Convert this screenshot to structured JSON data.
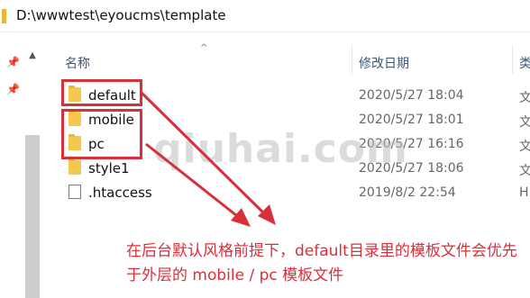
{
  "address_bar": {
    "path": "D:\\wwwtest\\eyoucms\\template"
  },
  "columns": {
    "name": "名称",
    "date": "修改日期",
    "type": "类"
  },
  "files": [
    {
      "name": "default",
      "date": "2020/5/27 18:04",
      "type": "文",
      "kind": "folder"
    },
    {
      "name": "mobile",
      "date": "2020/5/27 18:01",
      "type": "文",
      "kind": "folder"
    },
    {
      "name": "pc",
      "date": "2020/5/27 16:16",
      "type": "文",
      "kind": "folder"
    },
    {
      "name": "style1",
      "date": "2020/5/27 18:06",
      "type": "文",
      "kind": "folder"
    },
    {
      "name": ".htaccess",
      "date": "2019/8/2 22:54",
      "type": "H",
      "kind": "file"
    }
  ],
  "watermark": "qiuhai.com",
  "annotation": {
    "text": "在后台默认风格前提下，default目录里的模板文件会优先于外层的 mobile / pc 模板文件",
    "color": "#d8303a"
  },
  "icons": {
    "pin": "pin-icon",
    "folder": "folder-icon",
    "file": "file-icon"
  }
}
